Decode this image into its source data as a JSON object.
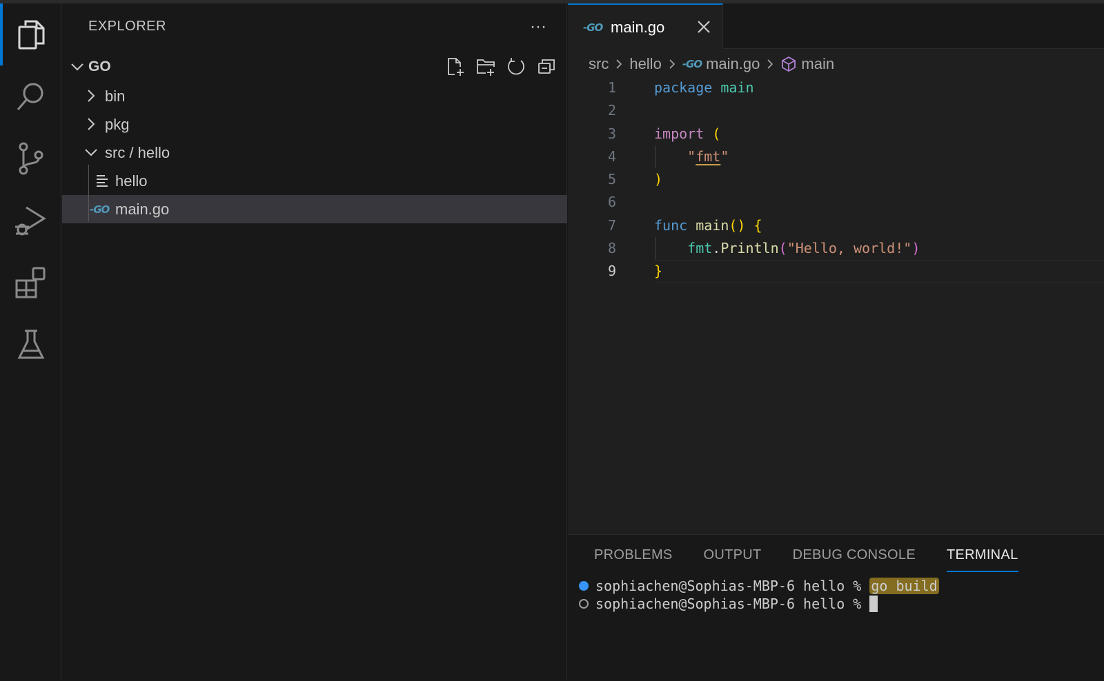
{
  "activity_bar": {
    "items": [
      {
        "name": "explorer",
        "icon": "files-icon",
        "active": true
      },
      {
        "name": "search",
        "icon": "search-icon",
        "active": false
      },
      {
        "name": "source-control",
        "icon": "source-control-icon",
        "active": false
      },
      {
        "name": "run-debug",
        "icon": "run-debug-icon",
        "active": false
      },
      {
        "name": "extensions",
        "icon": "extensions-icon",
        "active": false
      },
      {
        "name": "testing",
        "icon": "flask-icon",
        "active": false
      }
    ]
  },
  "sidebar": {
    "title": "EXPLORER",
    "more": "···",
    "root_folder": "GO",
    "tree": [
      {
        "label": "bin",
        "type": "folder",
        "expanded": false
      },
      {
        "label": "pkg",
        "type": "folder",
        "expanded": false
      },
      {
        "label": "src / hello",
        "type": "folder",
        "expanded": true
      },
      {
        "label": "hello",
        "type": "file",
        "icon": "text-file-icon"
      },
      {
        "label": "main.go",
        "type": "file",
        "icon": "go-file-icon",
        "selected": true
      }
    ]
  },
  "editor": {
    "tab": {
      "label": "main.go",
      "badge": "GO"
    },
    "breadcrumbs": [
      "src",
      "hello",
      "main.go",
      "main"
    ],
    "current_line": 9,
    "lines": [
      {
        "n": "1"
      },
      {
        "n": "2"
      },
      {
        "n": "3"
      },
      {
        "n": "4"
      },
      {
        "n": "5"
      },
      {
        "n": "6"
      },
      {
        "n": "7"
      },
      {
        "n": "8"
      },
      {
        "n": "9"
      }
    ],
    "code": {
      "l1_kw": "package",
      "l1_name": "main",
      "l3_kw": "import",
      "l3_open": "(",
      "l4_q1": "\"",
      "l4_str": "fmt",
      "l4_q2": "\"",
      "l5_close": ")",
      "l7_kw": "func",
      "l7_name": "main",
      "l7_parens": "()",
      "l7_brace": "{",
      "l8_pkg": "fmt",
      "l8_dot": ".",
      "l8_fn": "Println",
      "l8_open": "(",
      "l8_str": "\"Hello, world!\"",
      "l8_close": ")",
      "l9_brace": "}"
    }
  },
  "panel": {
    "tabs": [
      "PROBLEMS",
      "OUTPUT",
      "DEBUG CONSOLE",
      "TERMINAL"
    ],
    "active_tab": "TERMINAL",
    "terminal": {
      "prompt": "sophiachen@Sophias-MBP-6 hello % ",
      "command": "go build",
      "prompt2": "sophiachen@Sophias-MBP-6 hello % "
    }
  },
  "colors": {
    "accent": "#0078d4",
    "go_badge": "#519aba",
    "highlight": "#deb428"
  }
}
